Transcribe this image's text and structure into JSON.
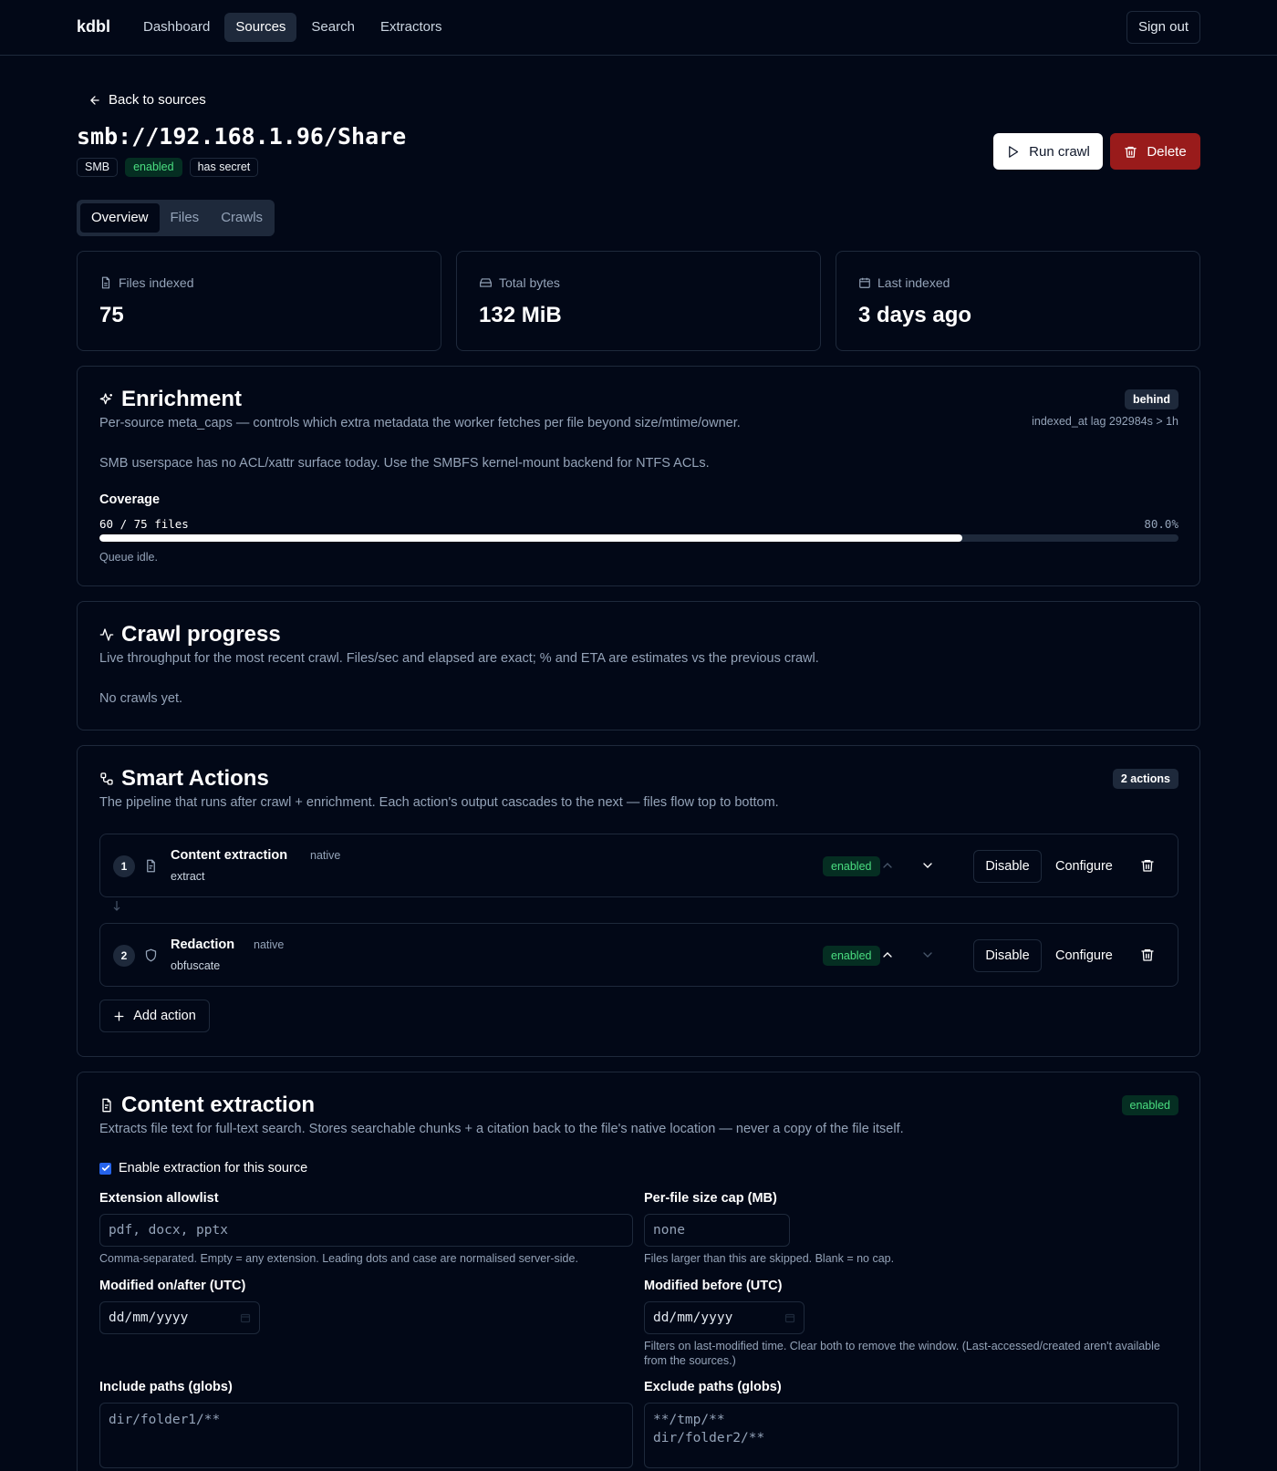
{
  "nav": {
    "logo": "kdbl",
    "links": [
      {
        "label": "Dashboard",
        "active": false
      },
      {
        "label": "Sources",
        "active": true
      },
      {
        "label": "Search",
        "active": false
      },
      {
        "label": "Extractors",
        "active": false
      }
    ],
    "sign_out": "Sign out"
  },
  "header": {
    "back_label": "Back to sources",
    "title": "smb://192.168.1.96/Share",
    "badges": [
      "SMB",
      "enabled",
      "has secret"
    ],
    "run_crawl": "Run crawl",
    "delete": "Delete"
  },
  "tabs": [
    "Overview",
    "Files",
    "Crawls"
  ],
  "stats": [
    {
      "label": "Files indexed",
      "value": "75",
      "icon": "file-icon"
    },
    {
      "label": "Total bytes",
      "value": "132 MiB",
      "icon": "hard-drive-icon"
    },
    {
      "label": "Last indexed",
      "value": "3 days ago",
      "icon": "calendar-icon"
    }
  ],
  "enrichment": {
    "title": "Enrichment",
    "description": "Per-source meta_caps — controls which extra metadata the worker fetches per file beyond size/mtime/owner.",
    "status_badge": "behind",
    "lag_text": "indexed_at lag 292984s > 1h",
    "note": "SMB userspace has no ACL/xattr surface today. Use the SMBFS kernel-mount backend for NTFS ACLs.",
    "coverage_label": "Coverage",
    "coverage_count": "60 / 75 files",
    "coverage_percent": "80.0%",
    "coverage_fraction": 0.8,
    "queue_status": "Queue idle."
  },
  "crawl_progress": {
    "title": "Crawl progress",
    "description": "Live throughput for the most recent crawl. Files/sec and elapsed are exact; % and ETA are estimates vs the previous crawl.",
    "empty": "No crawls yet."
  },
  "smart_actions": {
    "title": "Smart Actions",
    "count_badge": "2 actions",
    "description": "The pipeline that runs after crawl + enrichment. Each action's output cascades to the next — files flow top to bottom.",
    "actions": [
      {
        "index": "1",
        "name": "Content extraction",
        "kind": "native",
        "op": "extract",
        "status": "enabled",
        "disable": "Disable",
        "configure": "Configure"
      },
      {
        "index": "2",
        "name": "Redaction",
        "kind": "native",
        "op": "obfuscate",
        "status": "enabled",
        "disable": "Disable",
        "configure": "Configure"
      }
    ],
    "add_action": "Add action"
  },
  "content_extraction": {
    "title": "Content extraction",
    "status": "enabled",
    "description": "Extracts file text for full-text search. Stores searchable chunks + a citation back to the file's native location — never a copy of the file itself.",
    "enable_label": "Enable extraction for this source",
    "enable_checked": true,
    "ext_label": "Extension allowlist",
    "ext_placeholder": "pdf, docx, pptx",
    "ext_help": "Comma-separated. Empty = any extension. Leading dots and case are normalised server-side.",
    "size_label": "Per-file size cap (MB)",
    "size_placeholder": "none",
    "size_help": "Files larger than this are skipped. Blank = no cap.",
    "after_label": "Modified on/after (UTC)",
    "before_label": "Modified before (UTC)",
    "date_placeholder": "dd/mm/yyyy",
    "date_help": "Filters on last-modified time. Clear both to remove the window. (Last-accessed/created aren't available from the sources.)",
    "include_label": "Include paths (globs)",
    "include_placeholder": "dir/folder1/**",
    "exclude_label": "Exclude paths (globs)",
    "exclude_placeholder": "**/tmp/**\ndir/folder2/**"
  }
}
